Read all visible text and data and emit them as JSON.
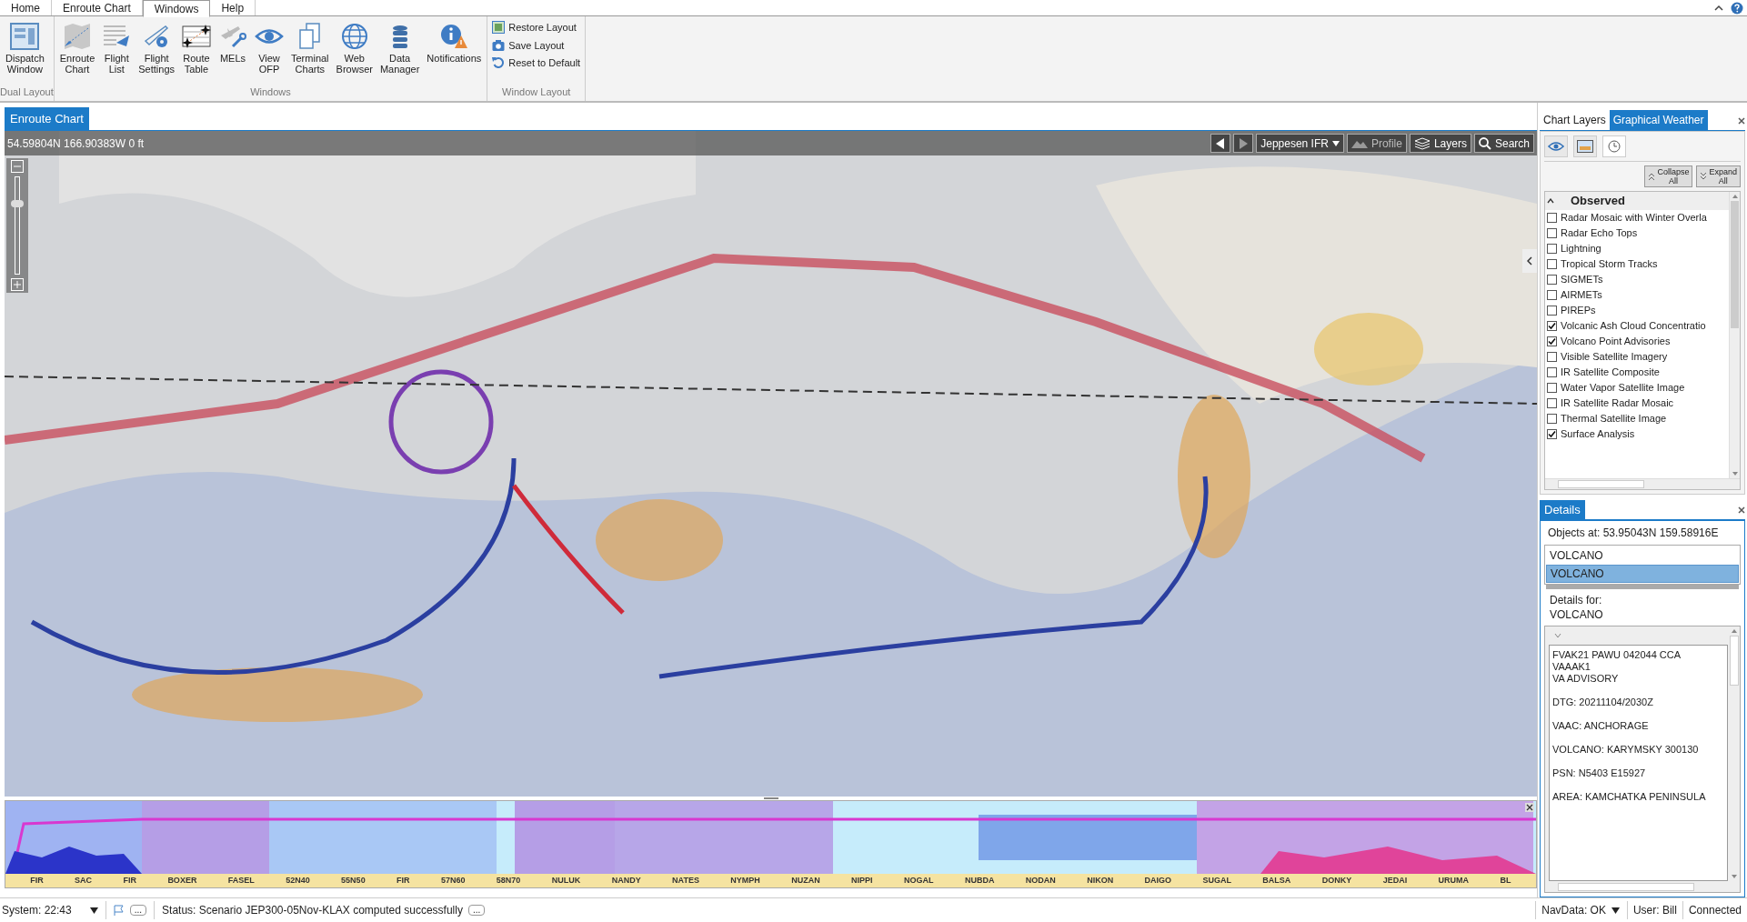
{
  "menu_tabs": [
    {
      "label": "Home",
      "selected": false
    },
    {
      "label": "Enroute Chart",
      "selected": false
    },
    {
      "label": "Windows",
      "selected": true
    },
    {
      "label": "Help",
      "selected": false
    }
  ],
  "ribbon": {
    "groups": [
      {
        "label": "Dual Layout",
        "kind": "large",
        "buttons": [
          "Dispatch\nWindow"
        ]
      },
      {
        "label": "Windows",
        "kind": "large",
        "buttons": [
          "Enroute\nChart",
          "Flight\nList",
          "Flight\nSettings",
          "Route\nTable",
          "MELs",
          "View\nOFP",
          "Terminal\nCharts",
          "Web\nBrowser",
          "Data\nManager",
          "Notifications"
        ]
      },
      {
        "label": "Window Layout",
        "kind": "small",
        "buttons": [
          "Restore Layout",
          "Save Layout",
          "Reset to Default"
        ]
      }
    ]
  },
  "document_tab": "Enroute Chart",
  "map": {
    "coordinates": "54.59804N  166.90383W  0 ft",
    "chart_type": "Jeppesen IFR",
    "buttons": [
      "Profile",
      "Layers",
      "Search"
    ],
    "zoom": {
      "level": 0.75
    }
  },
  "profile": {
    "labels": [
      "FIR",
      "SAC",
      "FIR",
      "BOXER",
      "FASEL",
      "52N40",
      "55N50",
      "FIR",
      "57N60",
      "58N70",
      "NULUK",
      "NANDY",
      "NATES",
      "NYMPH",
      "NUZAN",
      "NIPPI",
      "NOGAL",
      "NUBDA",
      "NODAN",
      "NIKON",
      "DAIGO",
      "SUGAL",
      "BALSA",
      "DONKY",
      "JEDAI",
      "URUMA",
      "BL"
    ]
  },
  "layers_panel": {
    "tabs": [
      {
        "label": "Chart Layers",
        "selected": false
      },
      {
        "label": "Graphical Weather",
        "selected": true
      }
    ],
    "collapse": "Collapse\nAll",
    "expand": "Expand\nAll",
    "section": "Observed",
    "layers": [
      {
        "label": "Radar Mosaic with Winter Overla",
        "checked": false
      },
      {
        "label": "Radar Echo Tops",
        "checked": false
      },
      {
        "label": "Lightning",
        "checked": false
      },
      {
        "label": "Tropical Storm Tracks",
        "checked": false
      },
      {
        "label": "SIGMETs",
        "checked": false
      },
      {
        "label": "AIRMETs",
        "checked": false
      },
      {
        "label": "PIREPs",
        "checked": false
      },
      {
        "label": "Volcanic Ash Cloud Concentratio",
        "checked": true
      },
      {
        "label": "Volcano Point Advisories",
        "checked": true
      },
      {
        "label": "Visible Satellite Imagery",
        "checked": false
      },
      {
        "label": "IR Satellite Composite",
        "checked": false
      },
      {
        "label": "Water Vapor Satellite Image",
        "checked": false
      },
      {
        "label": "IR Satellite Radar Mosaic",
        "checked": false
      },
      {
        "label": "Thermal Satellite Image",
        "checked": false
      },
      {
        "label": "Surface Analysis",
        "checked": true
      }
    ]
  },
  "details_panel": {
    "tab": "Details",
    "objects_at": "Objects at: 53.95043N  159.58916E",
    "objects": [
      {
        "label": "VOLCANO",
        "selected": false
      },
      {
        "label": "VOLCANO",
        "selected": true
      }
    ],
    "details_for": "Details for:\nVOLCANO",
    "paragraphs": [
      "FVAK21 PAWU 042044 CCA\nVAAAK1\nVA ADVISORY",
      "DTG: 20211104/2030Z",
      "VAAC: ANCHORAGE",
      "VOLCANO: KARYMSKY 300130",
      "PSN: N5403 E15927",
      "AREA: KAMCHATKA PENINSULA"
    ]
  },
  "status_bar": {
    "system": "System: 22:43",
    "status": "Status: Scenario JEP300-05Nov-KLAX computed successfully",
    "more": "...",
    "navdata": "NavData: OK",
    "user": "User: Bill",
    "connection": "Connected"
  }
}
